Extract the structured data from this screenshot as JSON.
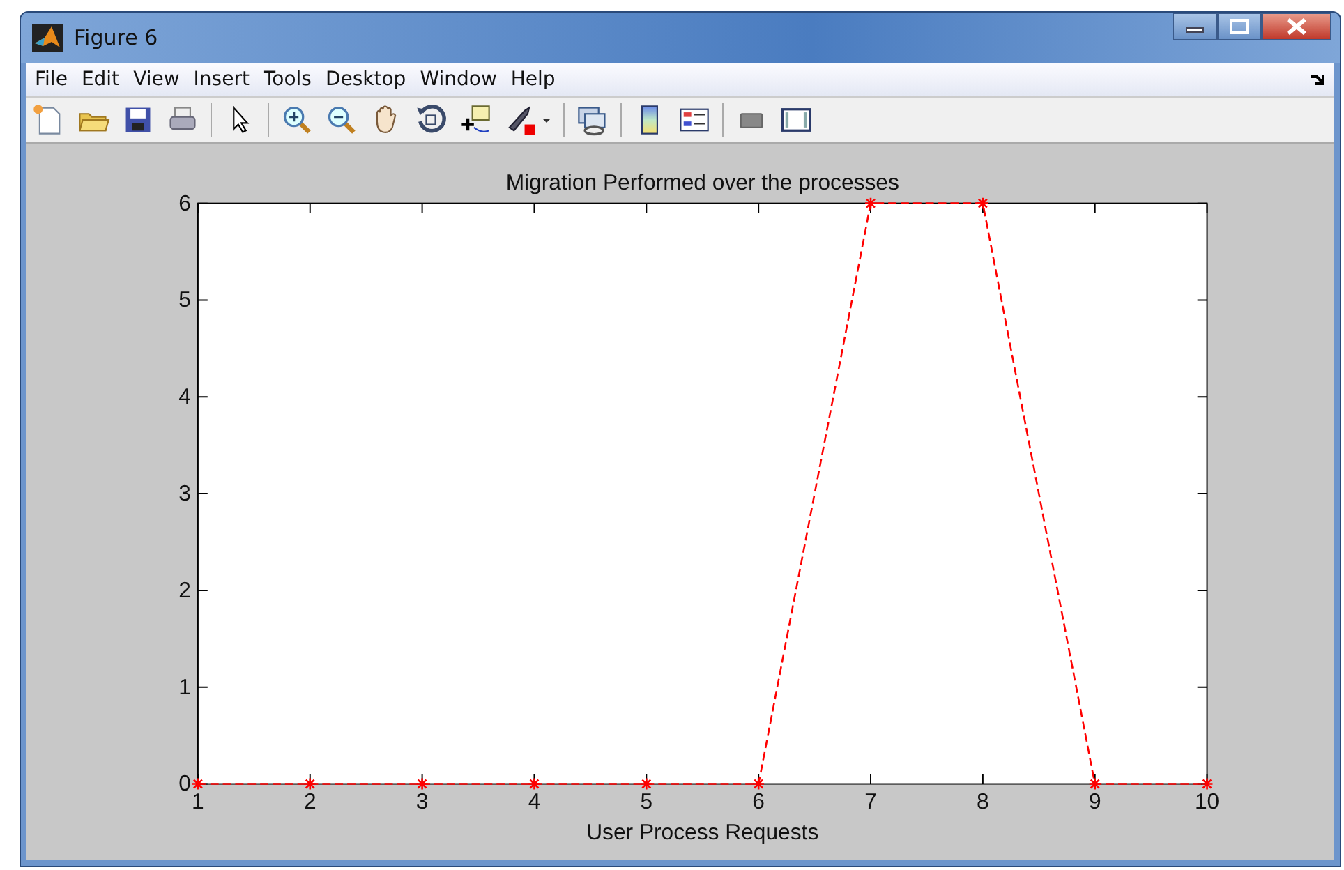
{
  "window": {
    "title": "Figure 6"
  },
  "menu": [
    "File",
    "Edit",
    "View",
    "Insert",
    "Tools",
    "Desktop",
    "Window",
    "Help"
  ],
  "figure": {
    "chart_data": {
      "type": "line",
      "title": "Migration Performed over the processes",
      "xlabel": "User Process Requests",
      "x": [
        1,
        2,
        3,
        4,
        5,
        6,
        7,
        8,
        9,
        10
      ],
      "series": [
        {
          "color": "#ff0000",
          "line_style": "dashed",
          "marker": "cross",
          "values": [
            0,
            0,
            0,
            0,
            0,
            0,
            6,
            6,
            0,
            0
          ]
        }
      ],
      "xlim": [
        1,
        10
      ],
      "ylim": [
        0,
        6
      ],
      "xticks": [
        1,
        2,
        3,
        4,
        5,
        6,
        7,
        8,
        9,
        10
      ],
      "yticks": [
        0,
        1,
        2,
        3,
        4,
        5,
        6
      ]
    }
  }
}
